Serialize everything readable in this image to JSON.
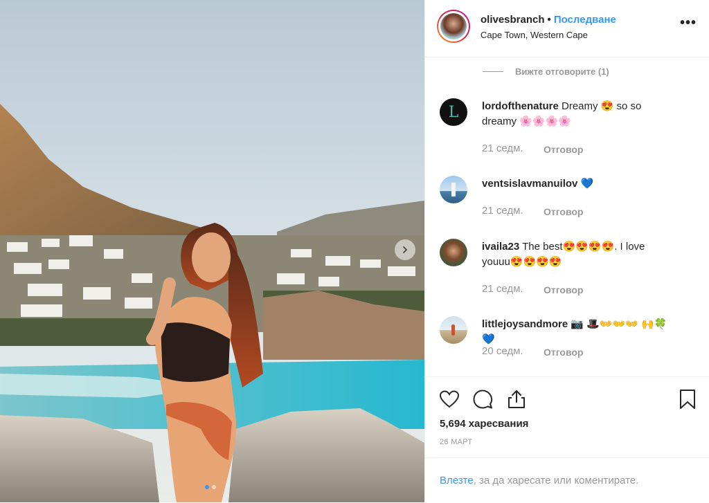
{
  "post": {
    "username": "olivesbranch",
    "follow_label": "Последване",
    "location": "Cape Town, Western Cape",
    "more_label": "•••"
  },
  "thread": {
    "view_replies_label": "Вижте отговорите (1)"
  },
  "comments": [
    {
      "user": "lordofthenature",
      "text": " Dreamy 😍 so so dreamy 🌸🌸🌸🌸",
      "time": "21 седм.",
      "reply": "Отговор",
      "avatar": "letter-L-avatar"
    },
    {
      "user": "ventsislavmanuilov",
      "text": " 💙",
      "time": "21 седм.",
      "reply": "Отговор",
      "avatar": "lighthouse-avatar"
    },
    {
      "user": "ivaila23",
      "text": " The best😍😍😍😍. I love youuu😍😍😍😍",
      "time": "21 седм.",
      "reply": "Отговор",
      "avatar": "portrait-avatar"
    },
    {
      "user": "littlejoysandmore",
      "text": " 📷 🎩👐👐👐 🙌🍀💙",
      "time": "20 седм.",
      "reply": "Отговор",
      "avatar": "beach-avatar"
    }
  ],
  "actions": {
    "likes_text": "5,694 харесвания",
    "date": "26 МАРТ"
  },
  "login": {
    "link": "Влезте",
    "rest": ", за да харесате или коментирате."
  },
  "colors": {
    "accent": "#3897f0",
    "muted": "#999999",
    "border": "#efefef"
  },
  "carousel": {
    "slide_count": 2,
    "active_index": 0
  }
}
